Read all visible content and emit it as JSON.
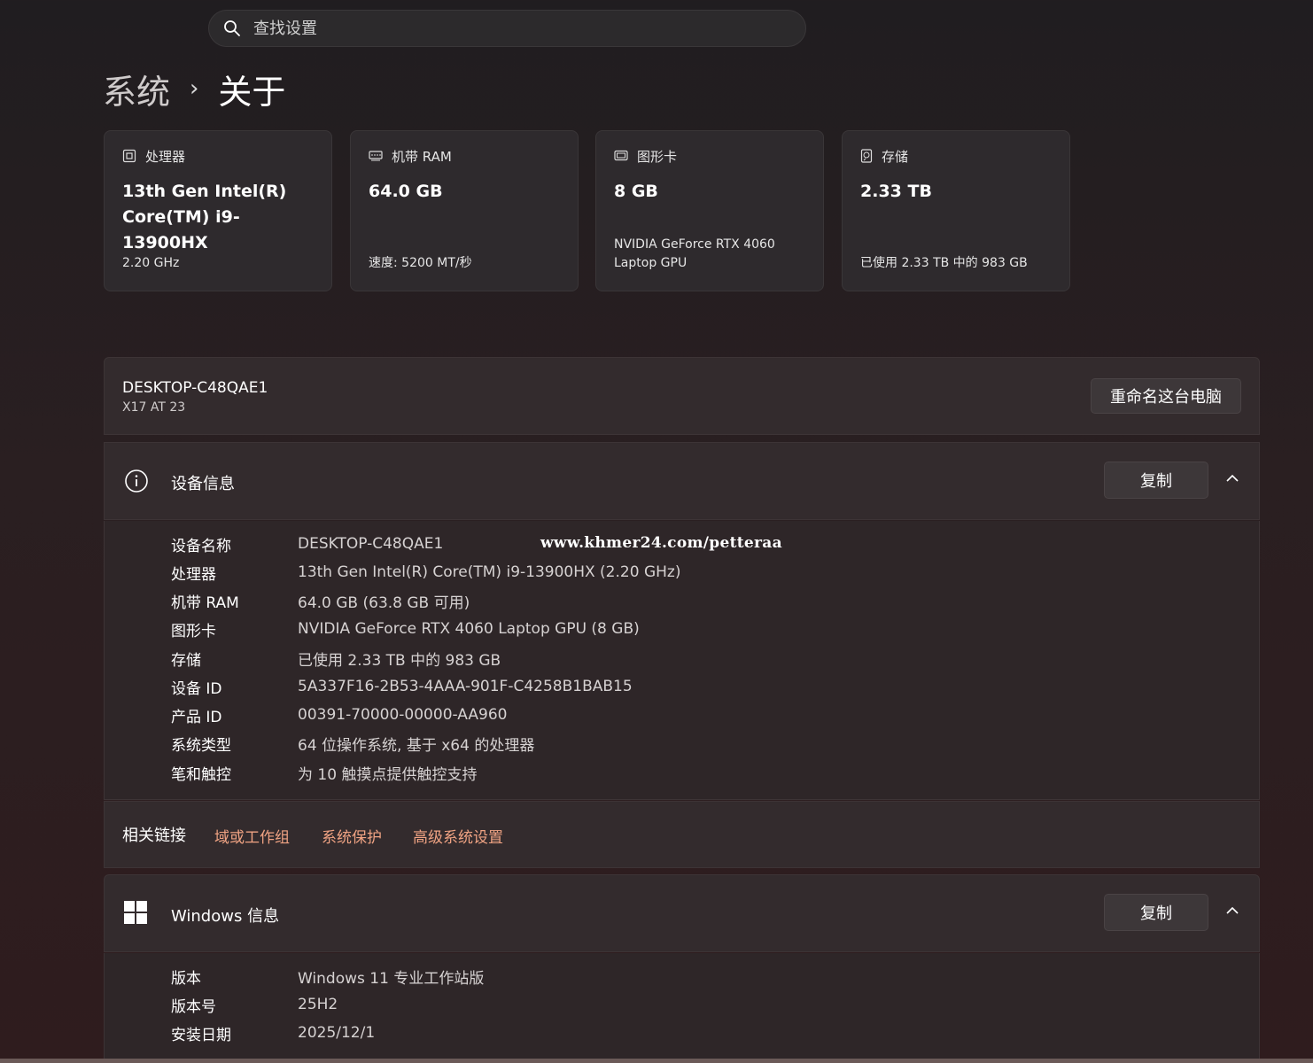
{
  "search": {
    "placeholder": "查找设置"
  },
  "breadcrumb": {
    "parent": "系统",
    "separator": "›",
    "current": "关于"
  },
  "cards": [
    {
      "icon": "processor-icon",
      "label": "处理器",
      "value": "13th Gen Intel(R) Core(TM) i9-13900HX",
      "sub": "2.20 GHz"
    },
    {
      "icon": "ram-icon",
      "label": "机带 RAM",
      "value": "64.0 GB",
      "sub": "速度: 5200 MT/秒"
    },
    {
      "icon": "graphics-card-icon",
      "label": "图形卡",
      "value": "8 GB",
      "sub": "NVIDIA GeForce RTX 4060 Laptop GPU"
    },
    {
      "icon": "storage-icon",
      "label": "存储",
      "value": "2.33 TB",
      "sub": "已使用 2.33 TB 中的 983 GB"
    }
  ],
  "pc": {
    "name": "DESKTOP-C48QAE1",
    "model": "X17 AT 23",
    "rename_label": "重命名这台电脑"
  },
  "device_info": {
    "title": "设备信息",
    "copy_label": "复制",
    "rows": [
      {
        "key": "设备名称",
        "value": "DESKTOP-C48QAE1"
      },
      {
        "key": "处理器",
        "value": "13th Gen Intel(R) Core(TM) i9-13900HX (2.20 GHz)"
      },
      {
        "key": "机带 RAM",
        "value": "64.0 GB (63.8 GB 可用)"
      },
      {
        "key": "图形卡",
        "value": "NVIDIA GeForce RTX 4060 Laptop GPU (8 GB)"
      },
      {
        "key": "存储",
        "value": "已使用 2.33 TB 中的 983 GB"
      },
      {
        "key": "设备 ID",
        "value": "5A337F16-2B53-4AAA-901F-C4258B1BAB15"
      },
      {
        "key": "产品 ID",
        "value": "00391-70000-00000-AA960"
      },
      {
        "key": "系统类型",
        "value": "64 位操作系统, 基于 x64 的处理器"
      },
      {
        "key": "笔和触控",
        "value": "为 10 触摸点提供触控支持"
      }
    ],
    "watermark": "www.khmer24.com/petteraa"
  },
  "related_links": {
    "label": "相关链接",
    "links": [
      "域或工作组",
      "系统保护",
      "高级系统设置"
    ]
  },
  "windows_info": {
    "title": "Windows 信息",
    "copy_label": "复制",
    "rows": [
      {
        "key": "版本",
        "value": "Windows 11 专业工作站版"
      },
      {
        "key": "版本号",
        "value": "25H2"
      },
      {
        "key": "安装日期",
        "value": "2025/12/1"
      }
    ]
  },
  "colors": {
    "link": "#f0a383",
    "panel": "#332b2d",
    "background": "#231e21"
  }
}
